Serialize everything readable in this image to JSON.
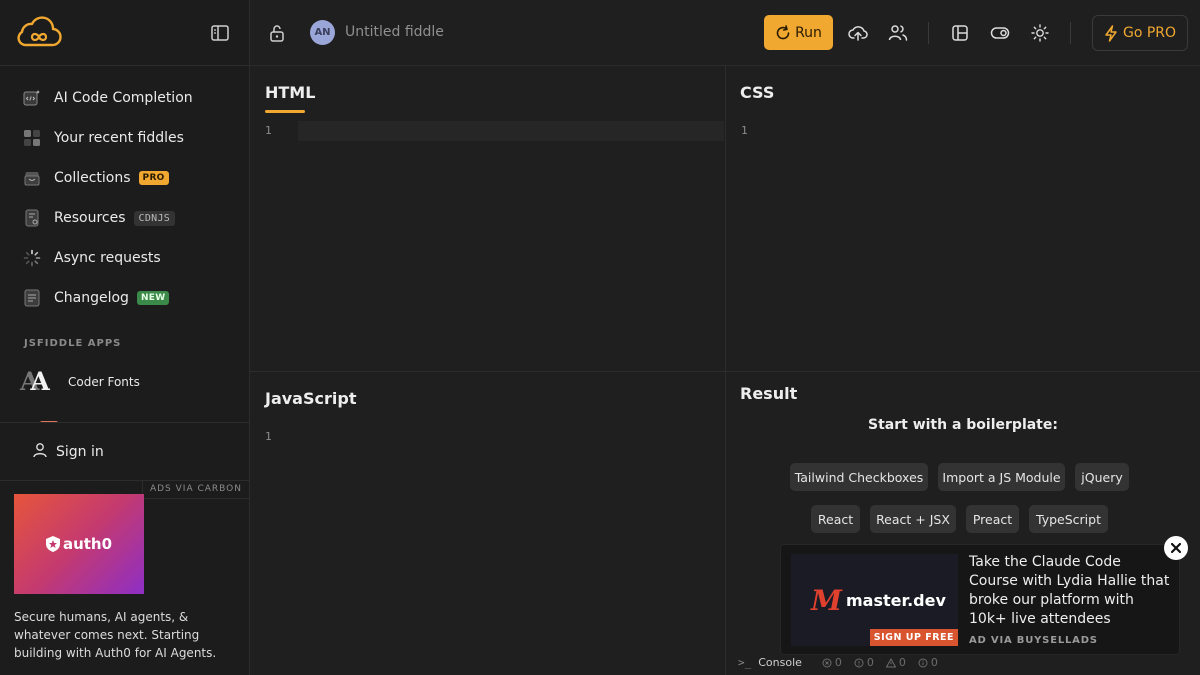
{
  "sidebar": {
    "nav": [
      {
        "label": "AI Code Completion",
        "icon": "ai-code-icon"
      },
      {
        "label": "Your recent fiddles",
        "icon": "grid-icon"
      },
      {
        "label": "Collections",
        "icon": "box-icon",
        "badge": "PRO"
      },
      {
        "label": "Resources",
        "icon": "file-icon",
        "badge": "CDNJS"
      },
      {
        "label": "Async requests",
        "icon": "spinner-icon"
      },
      {
        "label": "Changelog",
        "icon": "doc-icon",
        "badge": "NEW"
      }
    ],
    "apps_heading": "JSFIDDLE APPS",
    "apps": [
      {
        "label": "Coder Fonts",
        "logo_text": "AA"
      }
    ],
    "sign_in": "Sign in",
    "ad": {
      "label": "ADS VIA CARBON",
      "brand": "auth0",
      "text": "Secure humans, AI agents, & whatever comes next. Starting building with Auth0 for AI Agents."
    }
  },
  "topbar": {
    "avatar_initials": "AN",
    "title": "Untitled fiddle",
    "run_label": "Run",
    "gopro_label": "Go PRO"
  },
  "panes": {
    "html": {
      "title": "HTML",
      "line": "1"
    },
    "css": {
      "title": "CSS",
      "line": "1"
    },
    "js": {
      "title": "JavaScript",
      "line": "1"
    },
    "result": {
      "title": "Result"
    }
  },
  "boilerplate": {
    "title": "Start with a boilerplate:",
    "chips": [
      "Tailwind Checkboxes",
      "Import a JS Module",
      "jQuery",
      "React",
      "React + JSX",
      "Preact",
      "TypeScript"
    ]
  },
  "console": {
    "label": "Console",
    "counts": [
      "0",
      "0",
      "0",
      "0"
    ]
  },
  "float_ad": {
    "brand": "master.dev",
    "brand_mark": "M",
    "cta": "SIGN UP FREE",
    "text": "Take the Claude Code Course with Lydia Hallie that broke our platform with 10k+ live attendees",
    "via": "AD VIA BUYSELLADS"
  },
  "colors": {
    "accent": "#f0a830",
    "bg": "#1f1f1f",
    "sidebar": "#1c1c1c"
  }
}
